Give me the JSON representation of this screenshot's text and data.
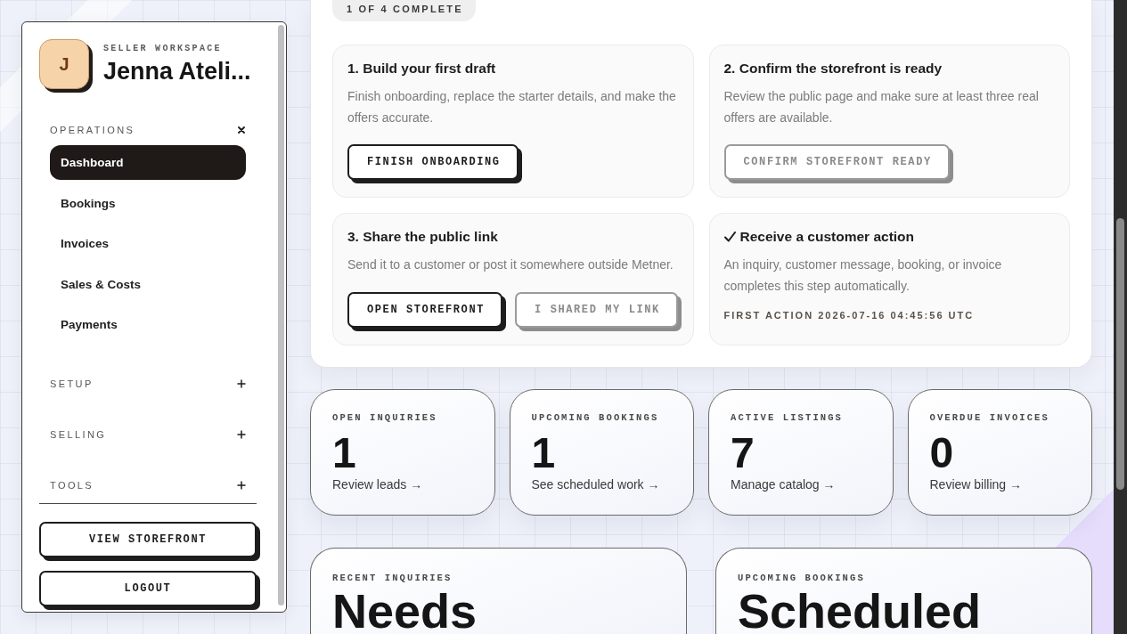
{
  "sidebar": {
    "avatar_initial": "J",
    "workspace_label": "SELLER WORKSPACE",
    "workspace_name": "Jenna Ateli...",
    "nav_groups": [
      {
        "label": "OPERATIONS",
        "expanded": true,
        "items": [
          {
            "label": "Dashboard",
            "selected": true
          },
          {
            "label": "Bookings",
            "selected": false
          },
          {
            "label": "Invoices",
            "selected": false
          },
          {
            "label": "Sales & Costs",
            "selected": false
          },
          {
            "label": "Payments",
            "selected": false
          }
        ]
      },
      {
        "label": "SETUP",
        "expanded": false
      },
      {
        "label": "SELLING",
        "expanded": false
      },
      {
        "label": "TOOLS",
        "expanded": false
      }
    ],
    "buttons": [
      "VIEW STOREFRONT",
      "LOGOUT"
    ]
  },
  "onboarding": {
    "progress": "1 OF 4 COMPLETE",
    "steps": [
      {
        "title": "1. Build your first draft",
        "complete": false,
        "description": "Finish onboarding, replace the starter details, and make the offers accurate.",
        "actions": [
          {
            "label": "FINISH ONBOARDING",
            "disabled": false
          }
        ]
      },
      {
        "title": "2. Confirm the storefront is ready",
        "complete": false,
        "description": "Review the public page and make sure at least three real offers are available.",
        "actions": [
          {
            "label": "CONFIRM STOREFRONT READY",
            "disabled": true
          }
        ]
      },
      {
        "title": "3. Share the public link",
        "complete": false,
        "description": "Send it to a customer or post it somewhere outside Metner.",
        "actions": [
          {
            "label": "OPEN STOREFRONT",
            "disabled": false
          },
          {
            "label": "I SHARED MY LINK",
            "disabled": true
          }
        ]
      },
      {
        "title": "Receive a customer action",
        "complete": true,
        "description": "An inquiry, customer message, booking, or invoice completes this step automatically.",
        "meta": "FIRST ACTION 2026-07-16 04:45:56 UTC"
      }
    ]
  },
  "stats": [
    {
      "label": "OPEN INQUIRIES",
      "value": "1",
      "link": "Review leads →"
    },
    {
      "label": "UPCOMING BOOKINGS",
      "value": "1",
      "link": "See scheduled work →"
    },
    {
      "label": "ACTIVE LISTINGS",
      "value": "7",
      "link": "Manage catalog →"
    },
    {
      "label": "OVERDUE INVOICES",
      "value": "0",
      "link": "Review billing →"
    }
  ],
  "panels": [
    {
      "label": "RECENT INQUIRIES",
      "headline": "Needs"
    },
    {
      "label": "UPCOMING BOOKINGS",
      "headline": "Scheduled"
    }
  ]
}
